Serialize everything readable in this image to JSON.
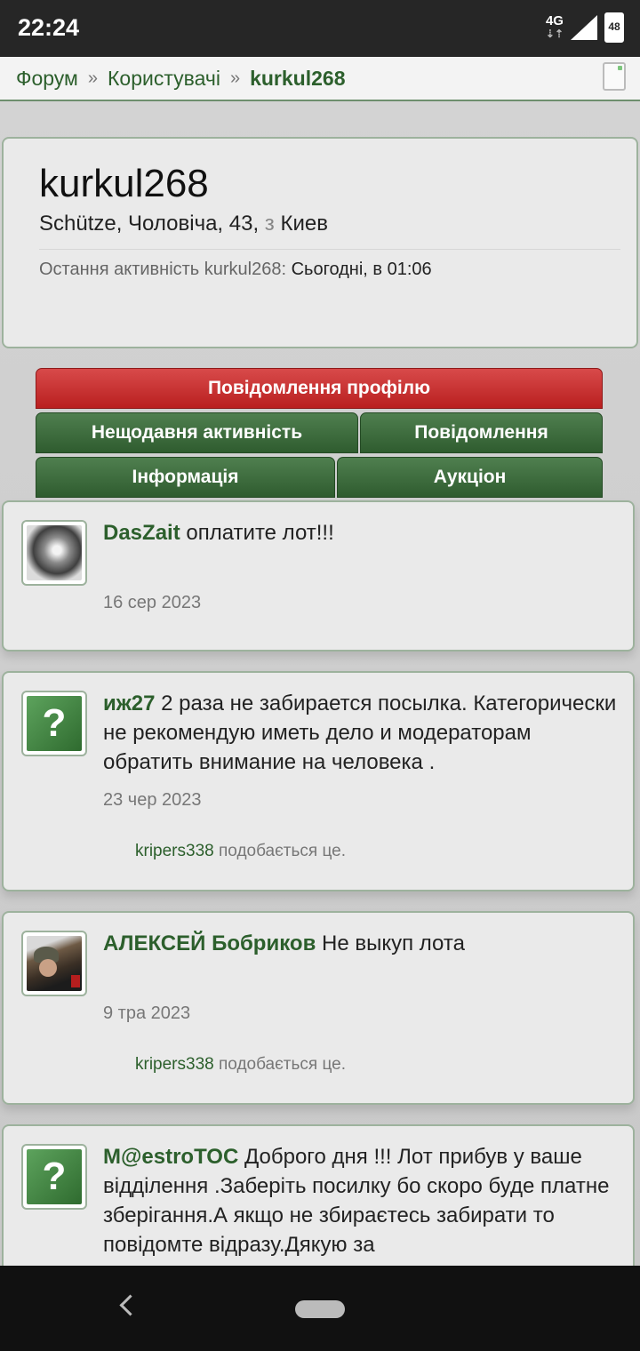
{
  "status": {
    "time": "22:24",
    "network": "4G",
    "battery": "48"
  },
  "breadcrumb": {
    "items": [
      "Форум",
      "Користувачі"
    ],
    "current": "kurkul268",
    "separator": "»"
  },
  "profile": {
    "username": "kurkul268",
    "info_before": "Schütze, Чоловіча, 43,",
    "info_from": "з",
    "info_city": "Киев",
    "last_activity_label": "Остання активність kurkul268:",
    "last_activity_value": "Сьогодні, в 01:06"
  },
  "tabs": {
    "profile_messages": "Повідомлення профілю",
    "recent_activity": "Нещодавня активність",
    "messages": "Повідомлення",
    "information": "Інформація",
    "auction": "Аукціон"
  },
  "posts": [
    {
      "author": "DasZait",
      "text": "оплатите лот!!!",
      "date": "16 сер 2023",
      "avatar": "photo-avatar"
    },
    {
      "author": "иж27",
      "text": "2 раза не забирается посылка. Категорически не рекомендую иметь дело и модераторам обратить внимание на человека .",
      "date": "23 чер 2023",
      "liker": "kripers338",
      "likes_suffix": "подобається це.",
      "avatar": "question-mark-avatar"
    },
    {
      "author": "АЛЕКСЕЙ Бобриков",
      "text": "Не выкуп лота",
      "date": "9 тра 2023",
      "liker": "kripers338",
      "likes_suffix": "подобається це.",
      "avatar": "soldier-photo-avatar"
    },
    {
      "author": "M@estroTOC",
      "text": "Доброго дня !!! Лот прибув у ваше відділення .Заберіть посилку бо скоро буде платне зберігання.А якщо не збираєтесь забирати то повідомте відразу.Дякую за",
      "avatar": "question-mark-avatar"
    }
  ],
  "avatar_glyph": "?"
}
